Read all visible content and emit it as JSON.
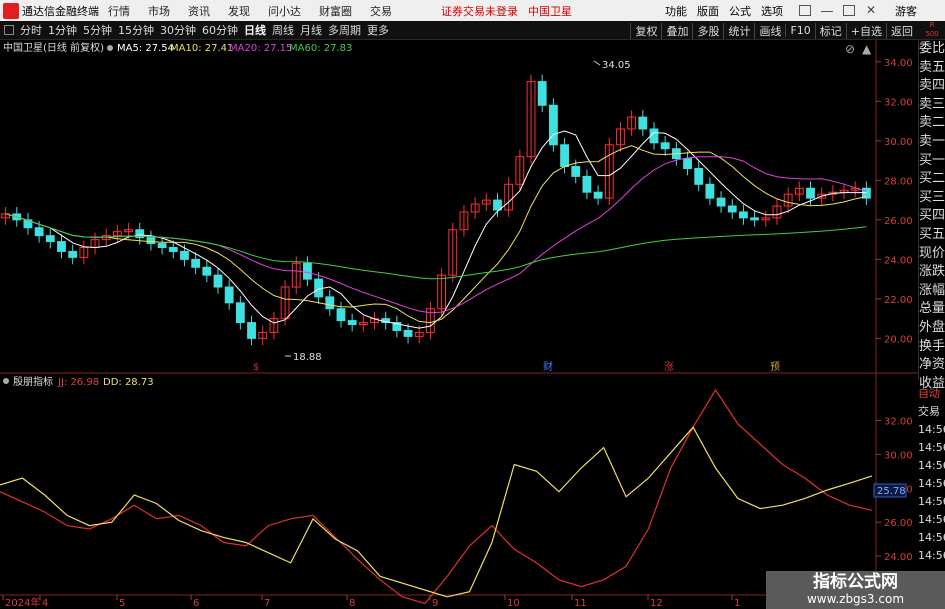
{
  "app": {
    "title": "通达信金融终端",
    "menu": [
      "行情",
      "市场",
      "资讯",
      "发现",
      "问小达",
      "财富圈",
      "交易"
    ],
    "login_status": "证券交易未登录",
    "stock": "中国卫星",
    "right_menu": [
      "功能",
      "版面",
      "公式",
      "选项"
    ],
    "user": "游客"
  },
  "toolbar": {
    "periods": [
      "分时",
      "1分钟",
      "5分钟",
      "15分钟",
      "30分钟",
      "60分钟",
      "日线",
      "周线",
      "月线",
      "多周期",
      "更多"
    ],
    "active": "日线",
    "right_tools": [
      "复权",
      "叠加",
      "多股",
      "统计",
      "画线",
      "F10",
      "标记",
      "+自选",
      "返回"
    ],
    "r_badge_top": "R",
    "r_badge_bottom": "500"
  },
  "main_chart": {
    "label": "中国卫星(日线 前复权)",
    "ma": [
      {
        "name": "MA5",
        "value": "27.54",
        "color": "#ffffff"
      },
      {
        "name": "MA10",
        "value": "27.41",
        "color": "#f0e060"
      },
      {
        "name": "MA20",
        "value": "27.15",
        "color": "#e040e0"
      },
      {
        "name": "MA60",
        "value": "27.83",
        "color": "#40d040"
      }
    ],
    "yticks": [
      "34.00",
      "32.00",
      "30.00",
      "28.00",
      "26.00",
      "24.00",
      "22.00",
      "20.00"
    ],
    "high_label": "34.05",
    "low_label": "18.88",
    "events": [
      "$",
      "财",
      "涨",
      "预"
    ]
  },
  "sub_chart": {
    "label": "殷朋指标",
    "jj": "JJ: 26.98",
    "dd": "DD: 28.73",
    "yticks": [
      "32.00",
      "30.00",
      "28.00",
      "26.00",
      "24.00"
    ],
    "current": "25.78"
  },
  "xaxis": {
    "labels": [
      "2024年",
      "4",
      "5",
      "6",
      "7",
      "8",
      "9",
      "10",
      "11",
      "12",
      "1"
    ]
  },
  "side_panel": {
    "items": [
      "委比",
      "卖五",
      "卖四",
      "卖三",
      "卖二",
      "卖一",
      "买一",
      "买二",
      "买三",
      "买四",
      "买五",
      "现价",
      "涨跌",
      "涨幅",
      "总量",
      "外盘",
      "换手",
      "净资",
      "收益"
    ]
  },
  "side_panel2": {
    "items": [
      "自动",
      "交易",
      "14:56",
      "14:56",
      "14:56",
      "14:56",
      "14:56",
      "14:56",
      "14:56",
      "14:56"
    ]
  },
  "watermark": {
    "line1": "指标公式网",
    "line2": "www.zbgs3.com"
  },
  "chart_data": {
    "type": "line",
    "price_series": [
      26.3,
      26.0,
      25.6,
      25.2,
      24.9,
      24.4,
      24.1,
      24.6,
      25.0,
      25.2,
      25.4,
      25.5,
      25.1,
      24.8,
      24.6,
      24.4,
      24.0,
      23.6,
      23.2,
      22.6,
      21.8,
      20.8,
      20.0,
      20.3,
      21.0,
      22.6,
      23.8,
      23.0,
      22.1,
      21.5,
      20.9,
      20.7,
      20.8,
      21.0,
      20.8,
      20.4,
      20.1,
      20.3,
      21.5,
      23.2,
      25.5,
      26.4,
      26.8,
      27.0,
      26.5,
      27.8,
      29.2,
      33.0,
      31.8,
      29.8,
      28.7,
      28.2,
      27.4,
      27.1,
      29.8,
      30.6,
      31.2,
      30.6,
      29.9,
      29.6,
      29.1,
      28.6,
      27.8,
      27.1,
      26.7,
      26.4,
      26.1,
      26.0,
      26.1,
      26.7,
      27.3,
      27.6,
      27.1,
      27.3,
      27.4,
      27.5,
      27.6,
      27.1
    ],
    "jj_series": [
      27.8,
      27.2,
      26.6,
      25.8,
      25.6,
      26.2,
      27.0,
      26.2,
      26.4,
      25.8,
      24.8,
      24.6,
      25.8,
      26.2,
      26.4,
      25.1,
      23.8,
      22.6,
      21.6,
      21.2,
      22.8,
      24.6,
      25.8,
      24.4,
      23.6,
      22.6,
      22.2,
      22.6,
      23.4,
      25.6,
      29.2,
      31.6,
      33.8,
      31.8,
      30.6,
      29.4,
      28.6,
      27.6,
      27.0,
      26.7
    ],
    "dd_series": [
      28.2,
      28.6,
      27.6,
      26.4,
      25.8,
      26.0,
      27.6,
      27.1,
      26.1,
      25.5,
      25.1,
      24.8,
      24.2,
      23.6,
      26.2,
      25.0,
      24.3,
      22.8,
      22.4,
      22.0,
      21.6,
      21.9,
      24.8,
      29.4,
      29.0,
      27.8,
      29.2,
      30.4,
      27.5,
      28.6,
      30.1,
      31.6,
      29.2,
      27.4,
      26.8,
      27.0,
      27.4,
      27.9,
      28.3,
      28.73
    ],
    "ylim_main": [
      18.5,
      34.7
    ],
    "ylim_sub": [
      22.0,
      33.5
    ]
  }
}
